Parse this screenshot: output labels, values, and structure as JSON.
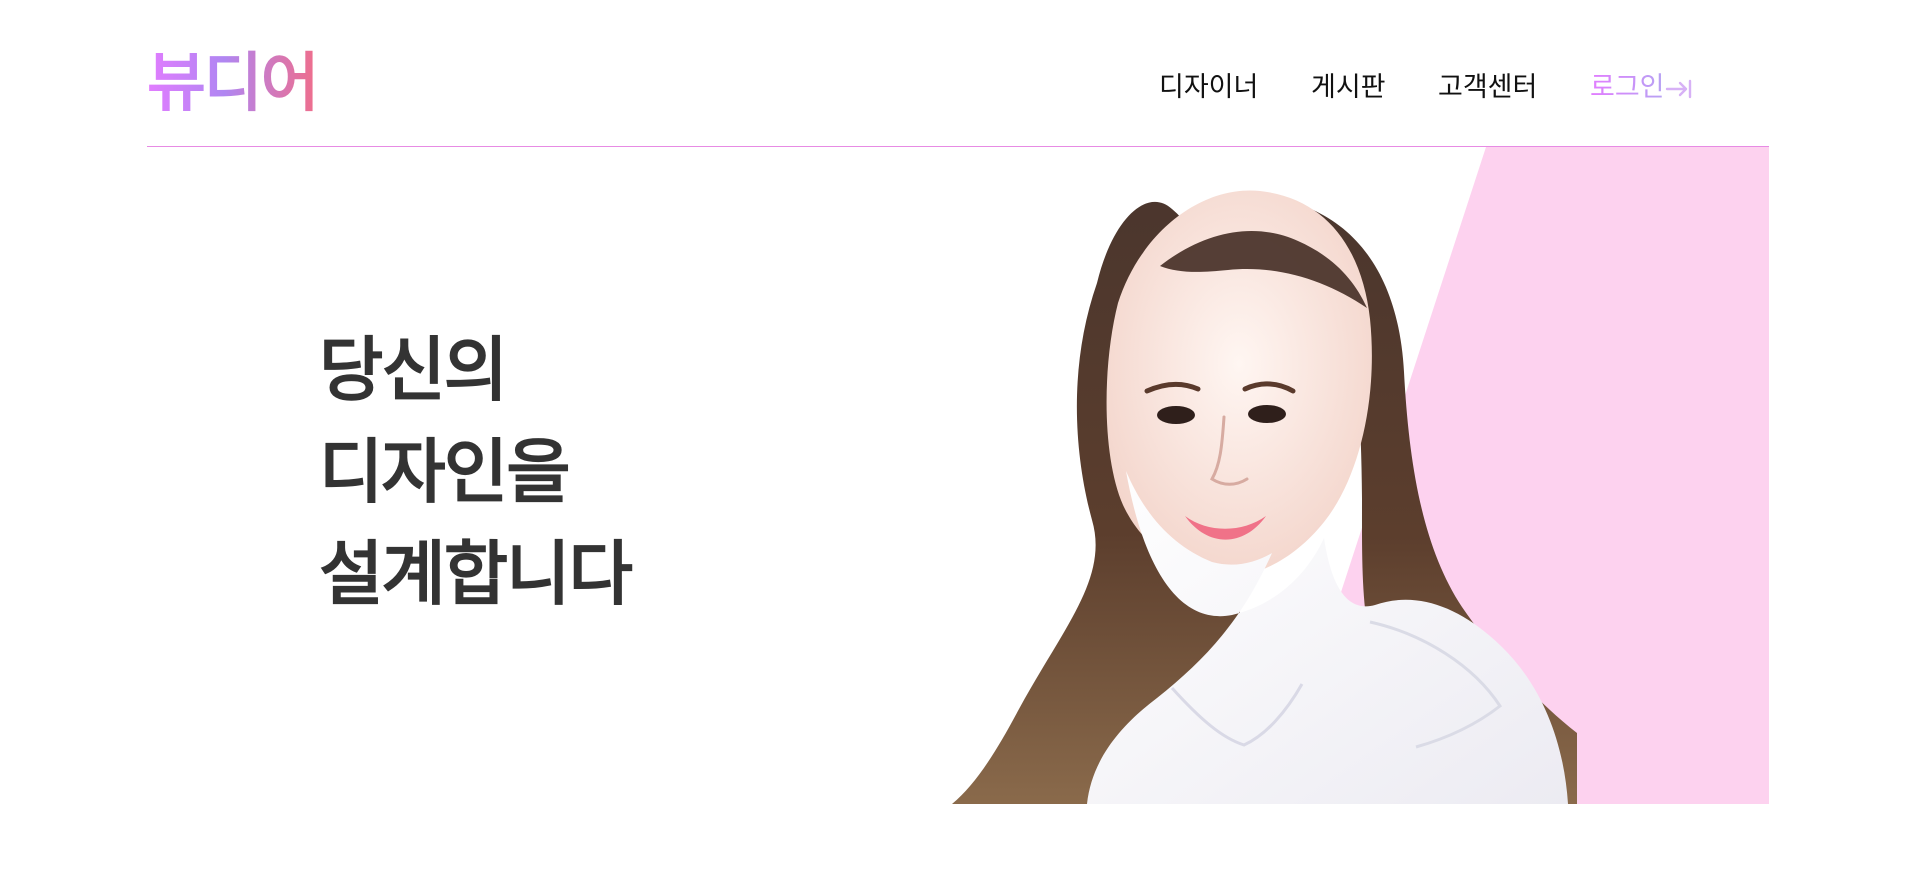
{
  "brand": {
    "logo_text": "뷰디어"
  },
  "nav": {
    "items": [
      "디자이너",
      "게시판",
      "고객센터"
    ],
    "login_label": "로그인",
    "login_icon": "arrow-right-to-bracket-icon"
  },
  "hero": {
    "headline_lines": [
      "당신의",
      "디자인을",
      "설계합니다"
    ],
    "image_subject": "portrait-photo",
    "accent_color": "#fdd2ef"
  }
}
